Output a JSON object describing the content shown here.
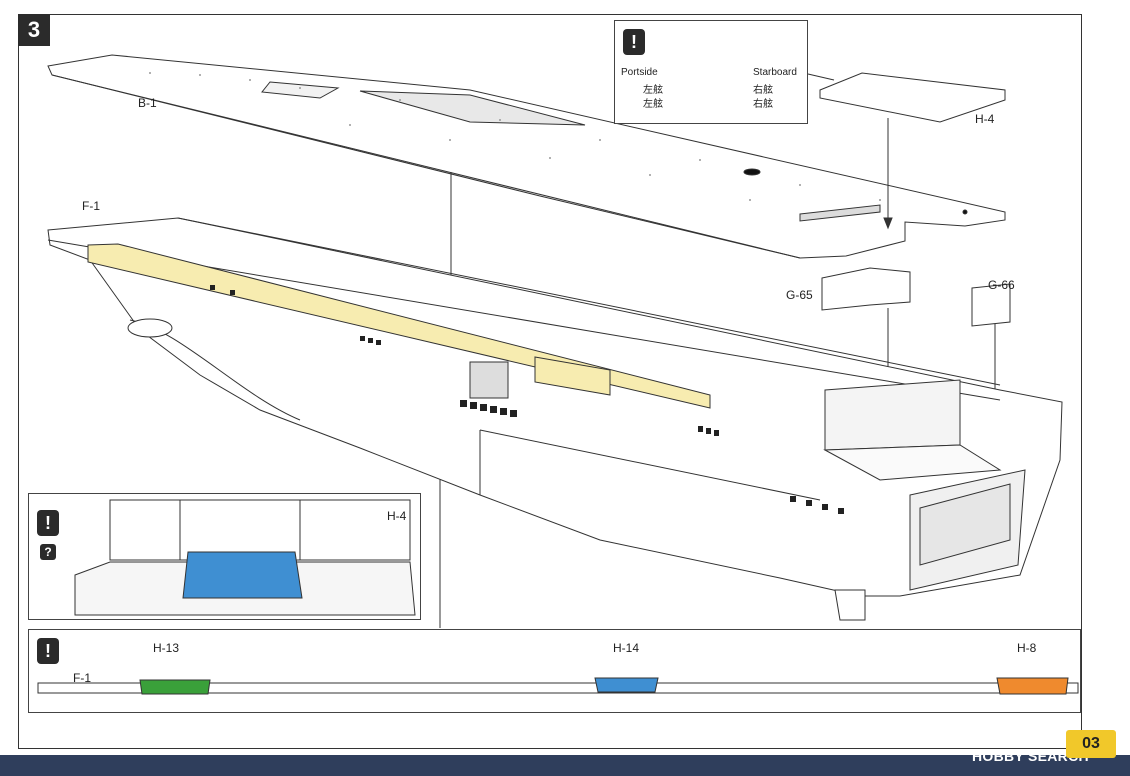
{
  "step": {
    "number": "3"
  },
  "parts": {
    "deck": "B-1",
    "rail": "F-1",
    "elevator_plate": "H-4",
    "stern_part_left": "G-65",
    "stern_part_right": "G-66"
  },
  "orientation_note": {
    "portside": "Portside",
    "portside_jp_1": "左舷",
    "portside_jp_2": "左舷",
    "starboard": "Starboard",
    "starboard_jp_1": "右舷",
    "starboard_jp_2": "右舷"
  },
  "detail_inset": {
    "part": "H-4",
    "question_mark": "?"
  },
  "rail_strip": {
    "rail": "F-1",
    "slot_1": "H-13",
    "slot_2": "H-14",
    "slot_3": "H-8"
  },
  "footer": {
    "page_number": "03",
    "watermark": "HOBBY SEARCH"
  },
  "colors": {
    "rail_highlight": "#f7ecb0",
    "elevator_blue": "#3f8fd2",
    "part_green": "#3aa03a",
    "part_blue": "#3f8fd2",
    "part_orange": "#ef8a2e",
    "footer_bar": "#2f3e5c",
    "page_badge": "#f1c82a"
  },
  "icons": [
    "exclamation-icon",
    "question-icon"
  ]
}
